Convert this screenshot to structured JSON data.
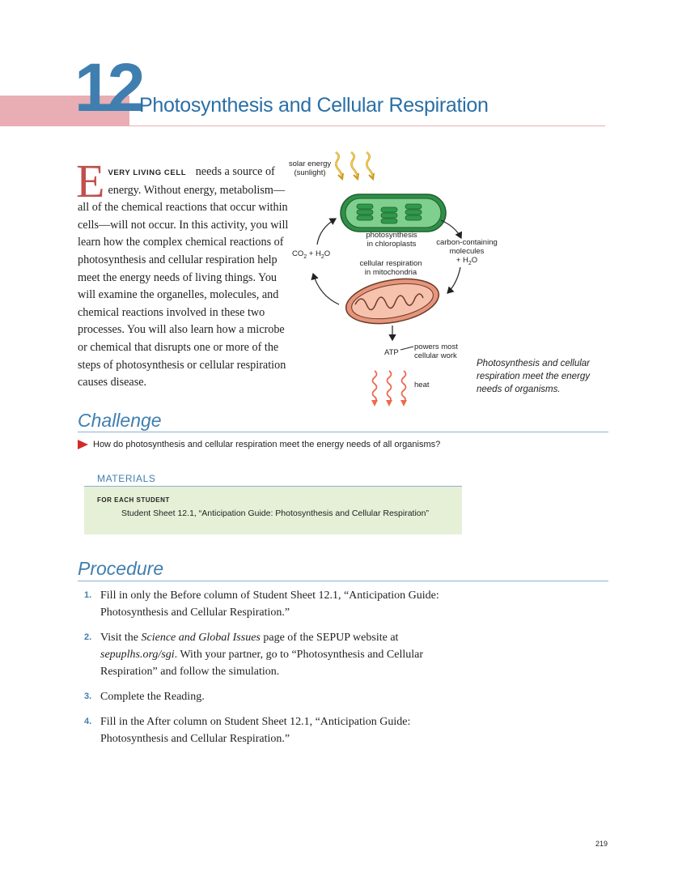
{
  "chapter": {
    "number": "12",
    "title": "Photosynthesis and Cellular Respiration"
  },
  "intro": {
    "dropcap": "E",
    "lead": "very living cell",
    "body": "needs a source of energy. Without energy, metabolism—all of the chemical reactions that occur within cells—will not occur. In this activity, you will learn how the complex chemical reactions of photosynthesis and cellular respiration help meet the energy needs of living things. You will examine the organelles, molecules, and chemical reactions involved in these two processes. You will also learn how a microbe or chemical that disrupts one or more of the steps of photosynthesis or cellular respiration causes disease."
  },
  "diagram": {
    "solar_energy": "solar energy",
    "sunlight": "(sunlight)",
    "photosynthesis_1": "photosynthesis",
    "photosynthesis_2": "in chloroplasts",
    "co2": "CO",
    "co2_sub": "2",
    "co2_plus": " + H",
    "h2o_sub": "2",
    "h2o_o": "O",
    "carbon_1": "carbon-containing",
    "carbon_2": "molecules",
    "carbon_3_pre": "+ H",
    "carbon_3_sub": "2",
    "carbon_3_post": "O",
    "respiration_1": "cellular respiration",
    "respiration_2": "in mitochondria",
    "atp": "ATP",
    "powers_1": "powers most",
    "powers_2": "cellular work",
    "heat": "heat",
    "colors": {
      "sun_arrow": "#f3c542",
      "chloroplast": "#3aa655",
      "mitochondrion": "#e0866a",
      "heat_arrow": "#ec6a50"
    }
  },
  "caption": "Photosynthesis and cellular respiration meet the energy needs of organisms.",
  "challenge": {
    "heading": "Challenge",
    "question": "How do photosynthesis and cellular respiration meet the energy needs of all organisms?"
  },
  "materials": {
    "heading": "MATERIALS",
    "for_each": "FOR EACH STUDENT",
    "item": "Student Sheet 12.1, “Anticipation Guide: Photosynthesis and Cellular Respiration”"
  },
  "procedure": {
    "heading": "Procedure",
    "steps": [
      {
        "num": "1.",
        "text": "Fill in only the Before column of Student Sheet 12.1, “Anticipation Guide: Photosynthesis and Cellular Respiration.”"
      },
      {
        "num": "2.",
        "text_a": "Visit the ",
        "text_italic": "Science and Global Issues",
        "text_b": " page of the SEPUP website at ",
        "text_url": "sepuplhs.org/sgi",
        "text_c": ". With your partner, go to “Photosynthesis and Cellular Respiration” and follow the simulation."
      },
      {
        "num": "3.",
        "text": "Complete the Reading."
      },
      {
        "num": "4.",
        "text": "Fill in the After column on Student Sheet 12.1, “Anticipation Guide: Photosynthesis and Cellular Respiration.”"
      }
    ]
  },
  "page_number": "219"
}
